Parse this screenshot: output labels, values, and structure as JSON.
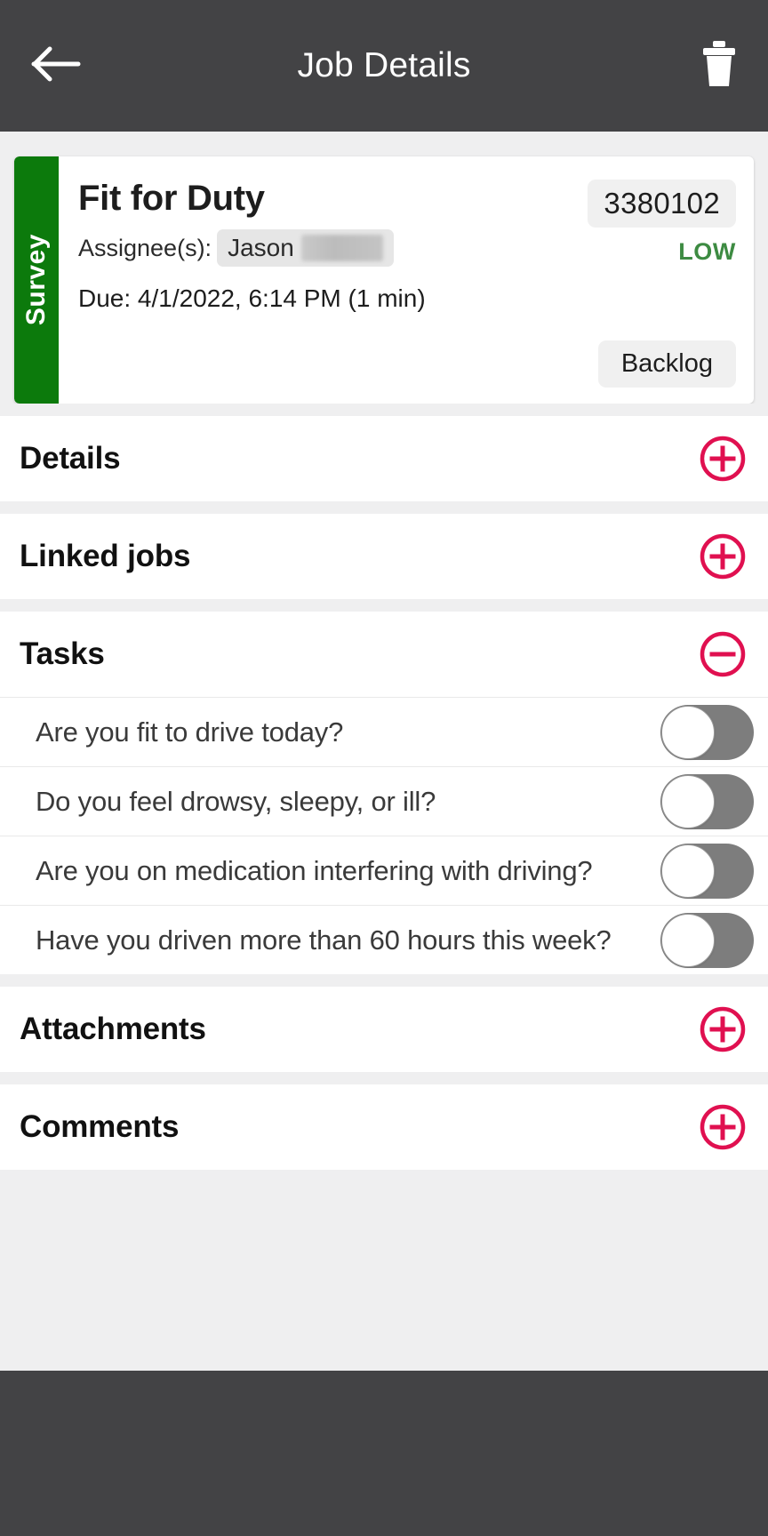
{
  "appbar": {
    "back_icon": "arrow-left-icon",
    "title": "Job Details",
    "delete_icon": "trash-icon"
  },
  "job_card": {
    "type_label": "Survey",
    "type_color": "#0c7a0c",
    "title": "Fit for Duty",
    "assignee_label": "Assignee(s):",
    "assignee_name": "Jason",
    "due": "Due: 4/1/2022, 6:14 PM (1 min)",
    "job_id": "3380102",
    "priority": "LOW",
    "priority_color": "#3d8b42",
    "status": "Backlog"
  },
  "accent_color": "#e01050",
  "sections": [
    {
      "title": "Details",
      "icon": "plus-circle-icon",
      "expanded": false
    },
    {
      "title": "Linked jobs",
      "icon": "plus-circle-icon",
      "expanded": false
    },
    {
      "title": "Tasks",
      "icon": "minus-circle-icon",
      "expanded": true
    },
    {
      "title": "Attachments",
      "icon": "plus-circle-icon",
      "expanded": false
    },
    {
      "title": "Comments",
      "icon": "plus-circle-icon",
      "expanded": false
    }
  ],
  "tasks": [
    {
      "label": "Are you fit to drive today?",
      "toggle_on": false
    },
    {
      "label": "Do you feel drowsy, sleepy, or ill?",
      "toggle_on": false
    },
    {
      "label": "Are you on medication interfering with driving?",
      "toggle_on": false
    },
    {
      "label": "Have you driven more than 60 hours this week?",
      "toggle_on": false
    }
  ]
}
